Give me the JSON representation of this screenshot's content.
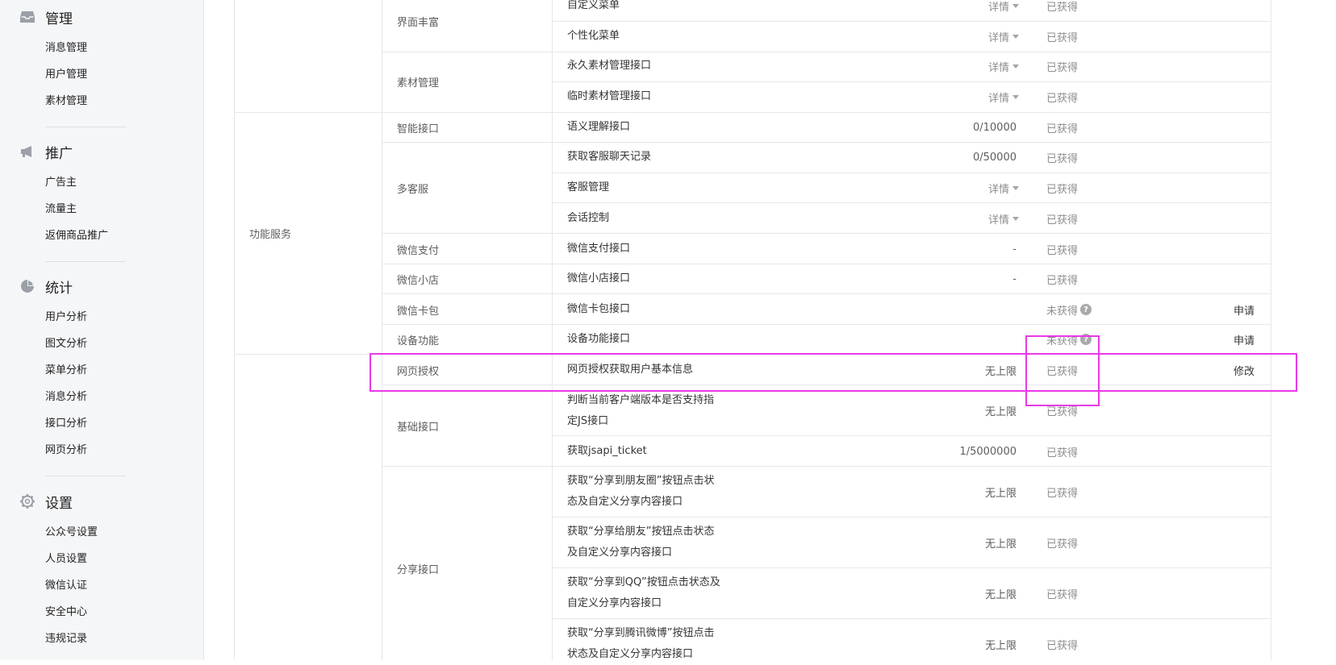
{
  "sidebar": {
    "groups": [
      {
        "title": "管理",
        "icon": "inbox-icon",
        "items": [
          "消息管理",
          "用户管理",
          "素材管理"
        ]
      },
      {
        "title": "推广",
        "icon": "megaphone-icon",
        "items": [
          "广告主",
          "流量主",
          "返佣商品推广"
        ]
      },
      {
        "title": "统计",
        "icon": "pie-chart-icon",
        "items": [
          "用户分析",
          "图文分析",
          "菜单分析",
          "消息分析",
          "接口分析",
          "网页分析"
        ]
      },
      {
        "title": "设置",
        "icon": "gear-icon",
        "items": [
          "公众号设置",
          "人员设置",
          "微信认证",
          "安全中心",
          "违规记录"
        ]
      }
    ]
  },
  "table": {
    "sections": [
      "功能服务"
    ],
    "categories": [
      "界面丰富",
      "素材管理",
      "智能接口",
      "多客服",
      "微信支付",
      "微信小店",
      "微信卡包",
      "设备功能",
      "网页授权",
      "基础接口",
      "分享接口"
    ],
    "rows": [
      {
        "name": "自定义菜单",
        "quota": "详情",
        "status": "已获得",
        "action": ""
      },
      {
        "name": "个性化菜单",
        "quota": "详情",
        "status": "已获得",
        "action": ""
      },
      {
        "name": "永久素材管理接口",
        "quota": "详情",
        "status": "已获得",
        "action": ""
      },
      {
        "name": "临时素材管理接口",
        "quota": "详情",
        "status": "已获得",
        "action": ""
      },
      {
        "name": "语义理解接口",
        "quota": "0/10000",
        "status": "已获得",
        "action": ""
      },
      {
        "name": "获取客服聊天记录",
        "quota": "0/50000",
        "status": "已获得",
        "action": ""
      },
      {
        "name": "客服管理",
        "quota": "详情",
        "status": "已获得",
        "action": ""
      },
      {
        "name": "会话控制",
        "quota": "详情",
        "status": "已获得",
        "action": ""
      },
      {
        "name": "微信支付接口",
        "quota": "-",
        "status": "已获得",
        "action": ""
      },
      {
        "name": "微信小店接口",
        "quota": "-",
        "status": "已获得",
        "action": ""
      },
      {
        "name": "微信卡包接口",
        "quota": "",
        "status": "未获得",
        "action": "申请"
      },
      {
        "name": "设备功能接口",
        "quota": "",
        "status": "未获得",
        "action": "申请"
      },
      {
        "name": "网页授权获取用户基本信息",
        "quota": "无上限",
        "status": "已获得",
        "action": "修改"
      },
      {
        "name": "判断当前客户端版本是否支持指定JS接口",
        "quota": "无上限",
        "status": "已获得",
        "action": ""
      },
      {
        "name": "获取jsapi_ticket",
        "quota": "1/5000000",
        "status": "已获得",
        "action": ""
      },
      {
        "name": "获取“分享到朋友圈”按钮点击状态及自定义分享内容接口",
        "quota": "无上限",
        "status": "已获得",
        "action": ""
      },
      {
        "name": "获取“分享给朋友”按钮点击状态及自定义分享内容接口",
        "quota": "无上限",
        "status": "已获得",
        "action": ""
      },
      {
        "name": "获取“分享到QQ”按钮点击状态及自定义分享内容接口",
        "quota": "无上限",
        "status": "已获得",
        "action": ""
      },
      {
        "name": "获取“分享到腾讯微博”按钮点击状态及自定义分享内容接口",
        "quota": "无上限",
        "status": "已获得",
        "action": ""
      }
    ],
    "question_mark": "?"
  },
  "colors": {
    "highlight": "#e83ae8",
    "sidebar_bg": "#f5f6f8",
    "border": "#e7e7eb"
  }
}
